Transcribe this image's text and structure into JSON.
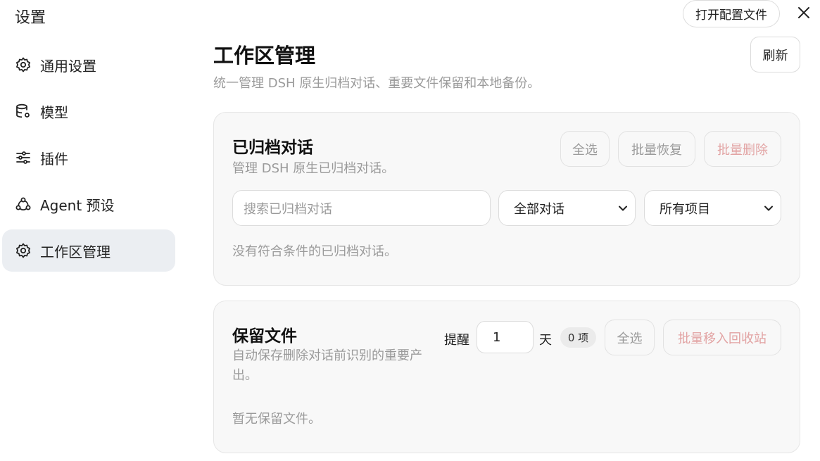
{
  "app": {
    "title": "设置",
    "open_config_label": "打开配置文件",
    "close_icon": "close-icon"
  },
  "sidebar": {
    "items": [
      {
        "label": "通用设置",
        "icon": "gear-icon"
      },
      {
        "label": "模型",
        "icon": "database-icon"
      },
      {
        "label": "插件",
        "icon": "sliders-icon"
      },
      {
        "label": "Agent 预设",
        "icon": "agent-icon"
      },
      {
        "label": "工作区管理",
        "icon": "gear-icon",
        "active": true
      }
    ]
  },
  "header": {
    "title": "工作区管理",
    "subtitle": "统一管理 DSH 原生归档对话、重要文件保留和本地备份。",
    "refresh_label": "刷新"
  },
  "archived": {
    "title": "已归档对话",
    "desc": "管理 DSH 原生已归档对话。",
    "select_all_label": "全选",
    "batch_restore_label": "批量恢复",
    "batch_delete_label": "批量删除",
    "search_placeholder": "搜索已归档对话",
    "filter_conversation": "全部对话",
    "filter_project": "所有项目",
    "empty_text": "没有符合条件的已归档对话。"
  },
  "retained": {
    "title": "保留文件",
    "desc": "自动保存删除对话前识别的重要产出。",
    "remind_label": "提醒",
    "days_value": "1",
    "days_unit": "天",
    "count_badge": "0 项",
    "select_all_label": "全选",
    "batch_trash_label": "批量移入回收站",
    "empty_text": "暂无保留文件。"
  },
  "colors": {
    "active_nav_bg": "#ebeef2",
    "card_bg": "#f8f8f8",
    "muted_text": "#9a9a9a",
    "danger_text": "#e2a3a3"
  }
}
